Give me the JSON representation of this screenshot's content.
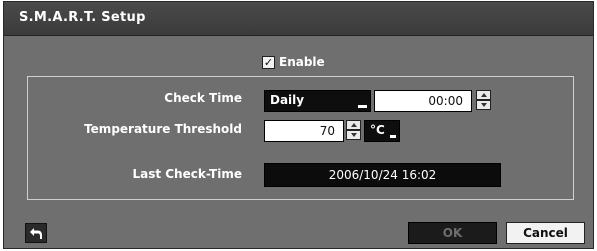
{
  "window": {
    "title": "S.M.A.R.T. Setup"
  },
  "enable": {
    "label": "Enable",
    "checked": true,
    "check_mark": "✓"
  },
  "check_time": {
    "label": "Check Time",
    "frequency": "Daily",
    "time": "00:00"
  },
  "temperature": {
    "label": "Temperature Threshold",
    "value": "70",
    "unit": "°C"
  },
  "last_check": {
    "label": "Last Check-Time",
    "value": "2006/10/24  16:02"
  },
  "buttons": {
    "back_icon": "back-arrow-icon",
    "ok": "OK",
    "cancel": "Cancel"
  }
}
